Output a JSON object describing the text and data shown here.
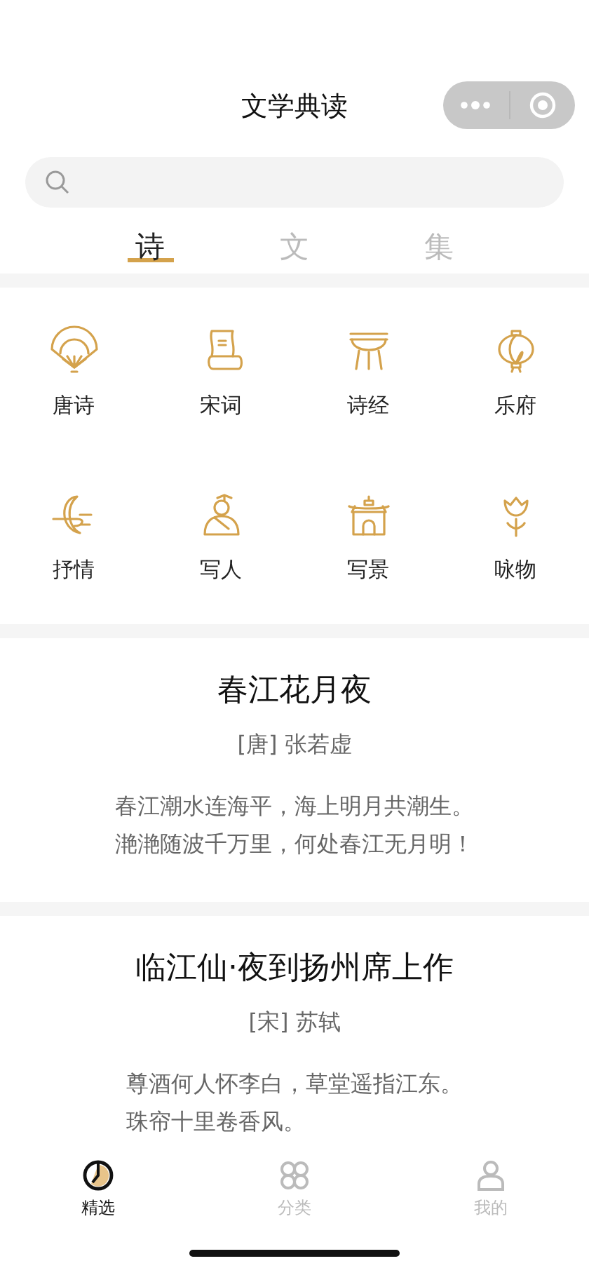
{
  "header": {
    "title": "文学典读"
  },
  "tabs": [
    {
      "label": "诗",
      "selected": true
    },
    {
      "label": "文",
      "selected": false
    },
    {
      "label": "集",
      "selected": false
    }
  ],
  "categories": [
    {
      "label": "唐诗"
    },
    {
      "label": "宋词"
    },
    {
      "label": "诗经"
    },
    {
      "label": "乐府"
    },
    {
      "label": "抒情"
    },
    {
      "label": "写人"
    },
    {
      "label": "写景"
    },
    {
      "label": "咏物"
    }
  ],
  "poems": [
    {
      "title": "春江花月夜",
      "author": "[唐] 张若虚",
      "lines": [
        "春江潮水连海平，海上明月共潮生。",
        "滟滟随波千万里，何处春江无月明！"
      ]
    },
    {
      "title": "临江仙·夜到扬州席上作",
      "author": "[宋] 苏轼",
      "lines": [
        "尊酒何人怀李白，草堂遥指江东。",
        "珠帘十里卷香风。"
      ]
    }
  ],
  "tab_bar": [
    {
      "label": "精选",
      "selected": true
    },
    {
      "label": "分类",
      "selected": false
    },
    {
      "label": "我的",
      "selected": false
    }
  ]
}
